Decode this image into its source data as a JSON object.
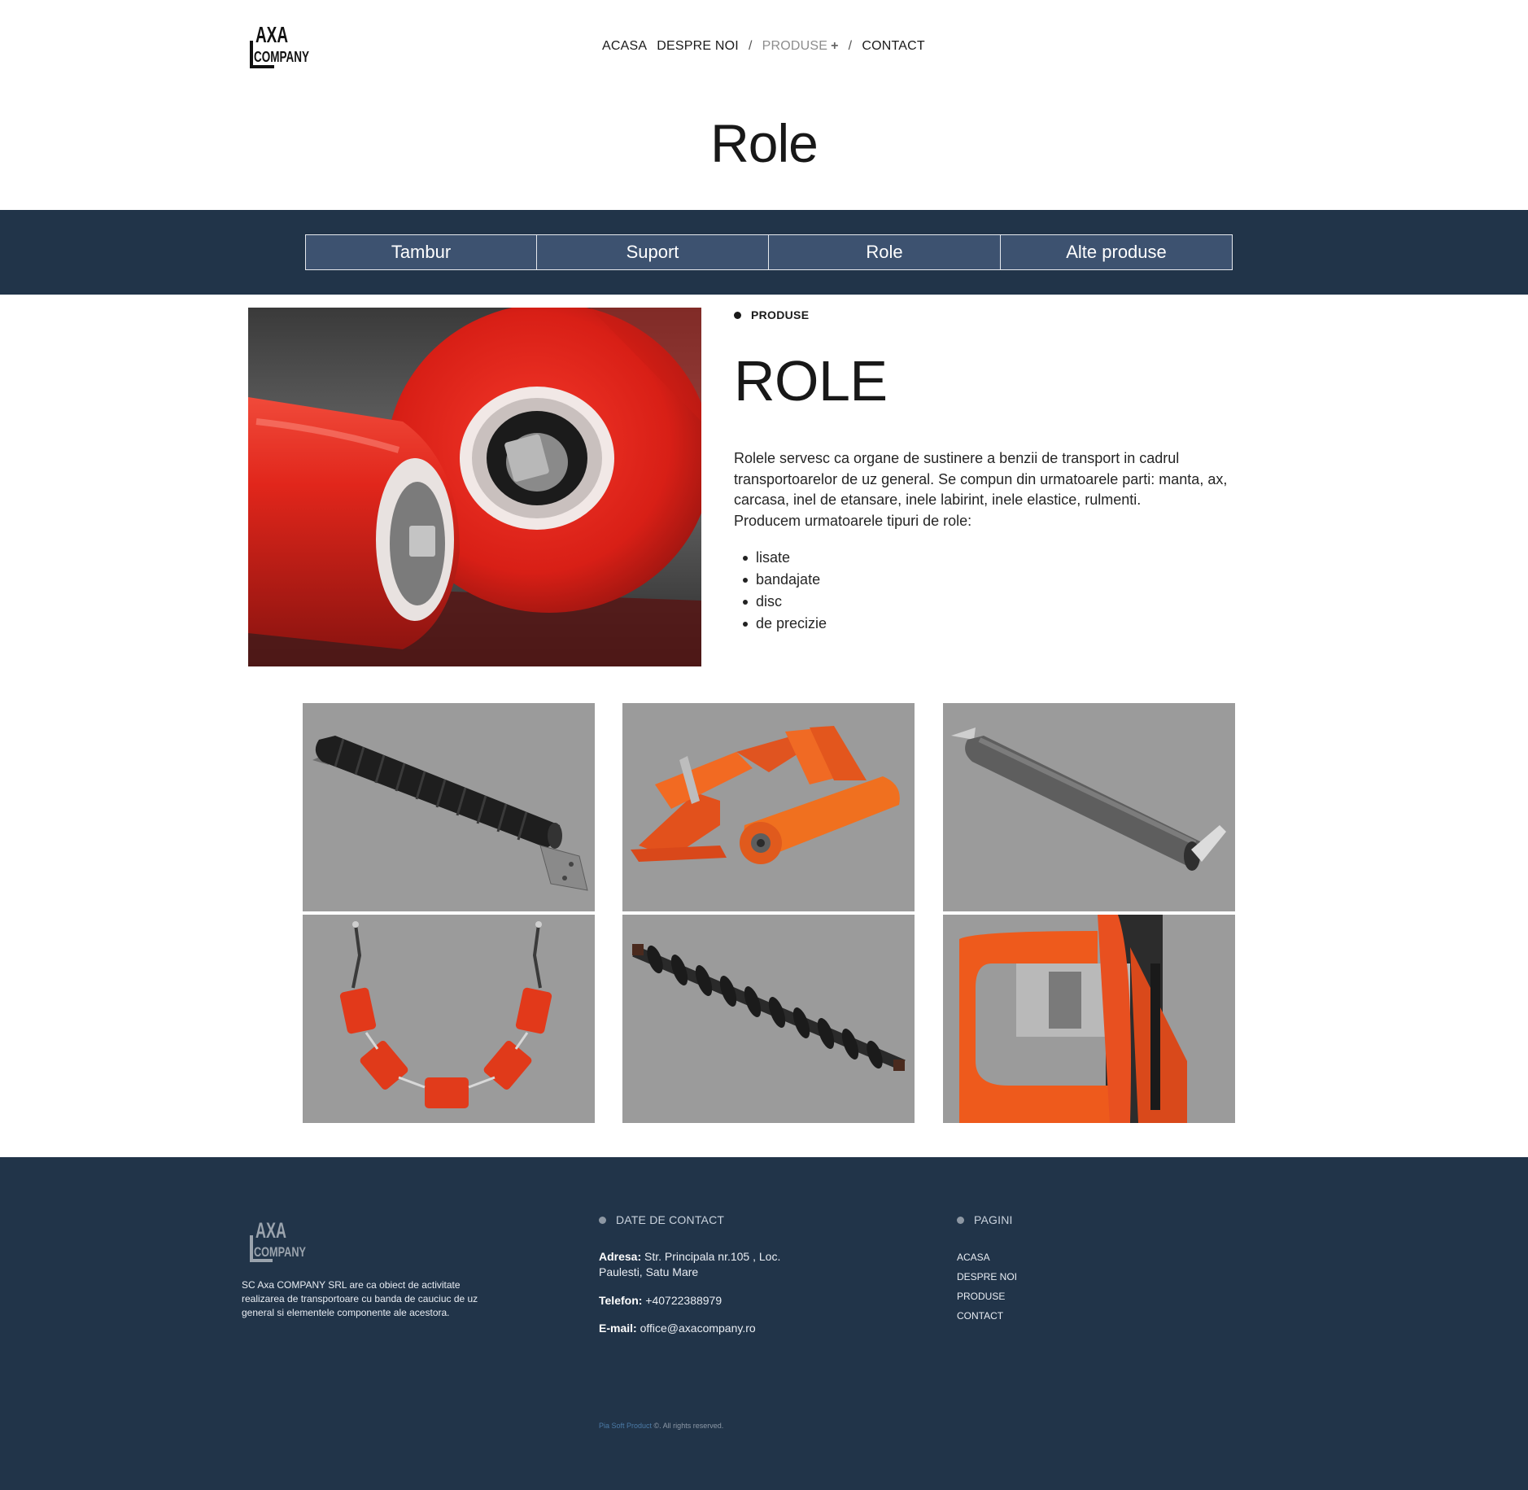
{
  "header": {
    "logo": {
      "line1": "AXA",
      "line2": "COMPANY"
    },
    "nav": [
      {
        "label": "ACASA",
        "active": false
      },
      {
        "label": "DESPRE NOI",
        "active": false
      },
      {
        "label": "PRODUSE",
        "active": true,
        "suffix": "+"
      },
      {
        "label": "CONTACT",
        "active": false
      }
    ],
    "separator": "/"
  },
  "page_title": "Role",
  "tabs": [
    "Tambur",
    "Suport",
    "Role",
    "Alte produse"
  ],
  "main": {
    "eyebrow": "PRODUSE",
    "heading": "ROLE",
    "description": "Rolele servesc ca organe de sustinere a benzii de transport in cadrul transportoarelor de uz general. Se compun din urmatoarele parti: manta, ax, carcasa, inel de etansare, inele labirint, inele elastice, rulmenti.",
    "intro_list": "Producem urmatoarele tipuri de role:",
    "types": [
      "lisate",
      "bandajate",
      "disc",
      "de precizie"
    ]
  },
  "gallery": [
    {
      "subject": "black rubber-ring impact roller on grey backdrop"
    },
    {
      "subject": "orange troughing idler frame with roller"
    },
    {
      "subject": "grey return roller with brackets"
    },
    {
      "subject": "garland of five red rollers on chains"
    },
    {
      "subject": "black spiral return roller"
    },
    {
      "subject": "close-up of orange roller bracket"
    }
  ],
  "footer": {
    "logo": {
      "line1": "AXA",
      "line2": "COMPANY"
    },
    "about": "SC Axa COMPANY SRL are ca obiect de activitate realizarea de transportoare cu banda de cauciuc de uz general si elementele componente ale acestora.",
    "contact_heading": "DATE DE CONTACT",
    "address_label": "Adresa:",
    "address_line1": "Str. Principala nr.105 , Loc.",
    "address_line2": "Paulesti, Satu Mare",
    "phone_label": "Telefon:",
    "phone": "+40722388979",
    "email_label": "E-mail:",
    "email": "office@axacompany.ro",
    "pages_heading": "PAGINI",
    "pages": [
      "ACASA",
      "DESPRE NOI",
      "PRODUSE",
      "CONTACT"
    ],
    "copyright_brand": "Pia Soft Product",
    "copyright_rest": " ©. All rights reserved."
  },
  "colors": {
    "dark_navy": "#213449",
    "tab_fill": "#3d5270",
    "roller_red": "#e2261c",
    "roller_orange": "#ee5a1c",
    "gallery_bg": "#9a9a9a"
  }
}
